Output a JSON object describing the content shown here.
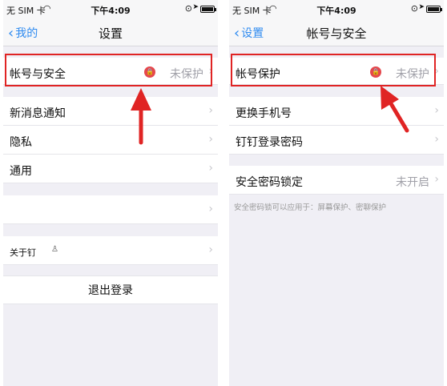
{
  "status_bar": {
    "carrier": "无 SIM 卡",
    "wifi_icon": "wifi-icon",
    "time": "下午4:09",
    "lock_icon": "rotation-lock-icon",
    "location_icon": "location-arrow-icon",
    "battery_level": 1.0
  },
  "left_screen": {
    "nav": {
      "back_label": "我的",
      "title": "设置"
    },
    "rows": {
      "account_security": {
        "label": "帐号与安全",
        "value": "未保护"
      },
      "notifications": {
        "label": "新消息通知"
      },
      "privacy": {
        "label": "隐私"
      },
      "general": {
        "label": "通用"
      },
      "about": {
        "label": "关于钉"
      }
    },
    "logout_label": "退出登录"
  },
  "right_screen": {
    "nav": {
      "back_label": "设置",
      "title": "帐号与安全"
    },
    "rows": {
      "account_protection": {
        "label": "帐号保护",
        "value": "未保护"
      },
      "change_phone": {
        "label": "更换手机号"
      },
      "login_password": {
        "label": "钉钉登录密码"
      },
      "security_lock": {
        "label": "安全密码锁定",
        "value": "未开启"
      }
    },
    "note": "安全密码锁可以应用于：屏幕保护、密聊保护"
  },
  "colors": {
    "accent": "#2f8bf0",
    "annotation": "#e02424",
    "lock_badge": "#e5484d"
  }
}
